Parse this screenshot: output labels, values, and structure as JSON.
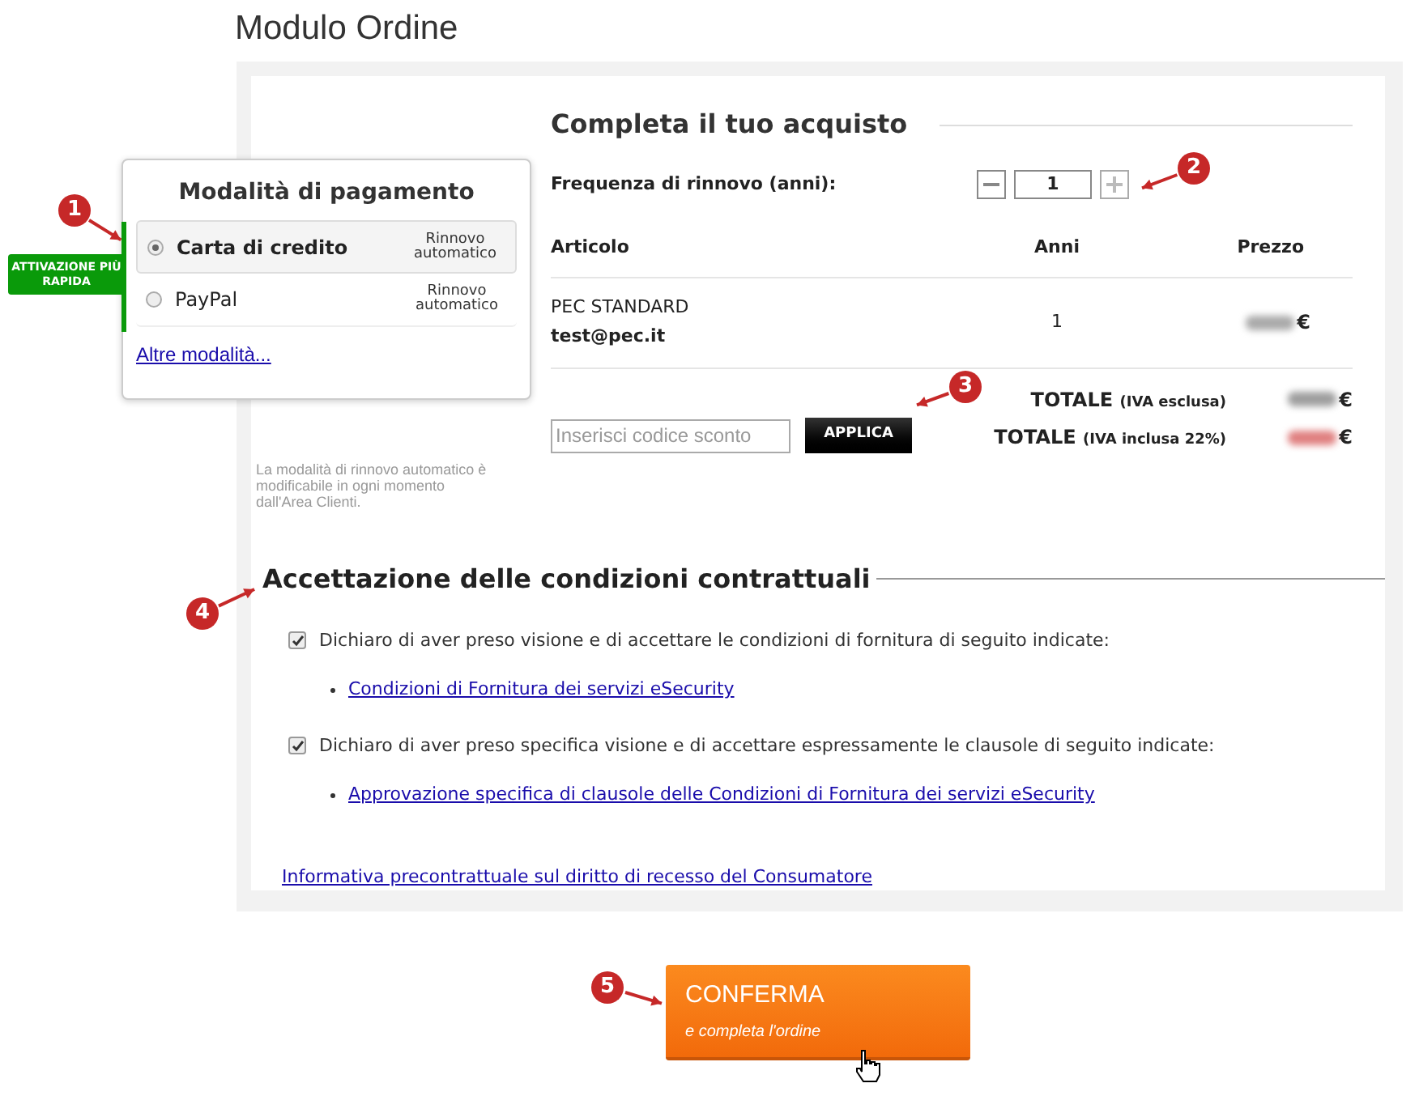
{
  "page_title": "Modulo Ordine",
  "payment": {
    "title": "Modalità di pagamento",
    "badge": "ATTIVAZIONE PIÙ RAPIDA",
    "options": [
      {
        "label": "Carta di credito",
        "note": "Rinnovo automatico",
        "selected": true
      },
      {
        "label": "PayPal",
        "note": "Rinnovo automatico",
        "selected": false
      }
    ],
    "more_link": "Altre modalità...",
    "footnote": "La modalità di rinnovo automatico è modificabile in ogni momento dall'Area Clienti."
  },
  "purchase": {
    "title": "Completa il tuo acquisto",
    "renewal": {
      "label": "Frequenza di rinnovo (anni):",
      "value": "1"
    },
    "table": {
      "columns": [
        "Articolo",
        "Anni",
        "Prezzo"
      ],
      "rows": [
        {
          "product": "PEC STANDARD",
          "email": "test@pec.it",
          "years": "1",
          "currency": "€"
        }
      ]
    },
    "discount": {
      "placeholder": "Inserisci codice sconto",
      "button": "APPLICA"
    },
    "totals": [
      {
        "label": "TOTALE",
        "qualifier": "(IVA esclusa)",
        "currency": "€",
        "color": "#9e9e9e"
      },
      {
        "label": "TOTALE",
        "qualifier": "(IVA inclusa 22%)",
        "currency": "€",
        "color": "#e08080"
      }
    ]
  },
  "terms": {
    "title": "Accettazione delle condizioni contrattuali",
    "items": [
      {
        "text": "Dichiaro di aver preso visione e di accettare le condizioni di fornitura di seguito indicate:",
        "checked": true,
        "link": "Condizioni di Fornitura dei servizi eSecurity"
      },
      {
        "text": "Dichiaro di aver preso specifica visione e di accettare espressamente le clausole di seguito indicate:",
        "checked": true,
        "link": "Approvazione specifica di clausole delle Condizioni di Fornitura dei servizi eSecurity"
      }
    ],
    "withdrawal_link": "Informativa precontrattuale sul diritto di recesso del Consumatore"
  },
  "confirm": {
    "label": "CONFERMA",
    "sublabel": "e completa l'ordine"
  },
  "markers": [
    "1",
    "2",
    "3",
    "4",
    "5"
  ]
}
